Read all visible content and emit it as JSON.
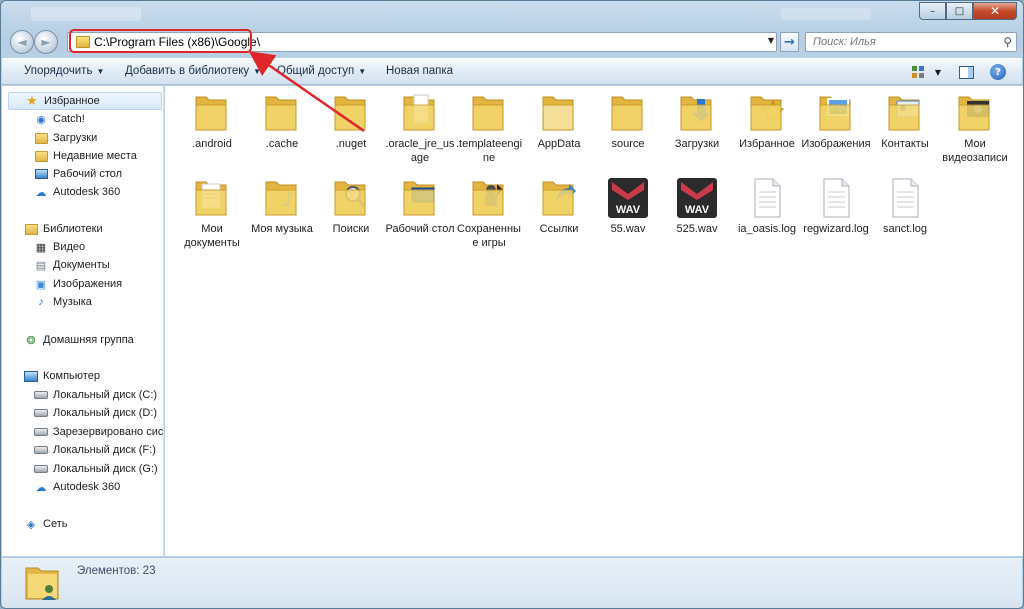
{
  "window": {
    "controls": {
      "minimize": "–",
      "maximize": "□",
      "close": "✕"
    }
  },
  "nav": {
    "back_icon": "◄",
    "forward_icon": "►",
    "address": "C:\\Program Files (x86)\\Google\\",
    "go_icon": "→",
    "search_placeholder": "Поиск: Илья"
  },
  "toolbar": {
    "organize": "Упорядочить",
    "add_to_library": "Добавить в библиотеку",
    "share": "Общий доступ",
    "new_folder": "Новая папка"
  },
  "sidebar": {
    "favorites": "Избранное",
    "favorites_items": [
      "Catch!",
      "Загрузки",
      "Недавние места",
      "Рабочий стол",
      "Autodesk 360"
    ],
    "libraries": "Библиотеки",
    "libraries_items": [
      "Видео",
      "Документы",
      "Изображения",
      "Музыка"
    ],
    "homegroup": "Домашняя группа",
    "computer": "Компьютер",
    "computer_items": [
      "Локальный диск (C:)",
      "Локальный диск (D:)",
      "Зарезервировано системой",
      "Локальный диск (F:)",
      "Локальный диск (G:)",
      "Autodesk 360"
    ],
    "network": "Сеть"
  },
  "files": [
    {
      "name": ".android",
      "type": "folder"
    },
    {
      "name": ".cache",
      "type": "folder"
    },
    {
      "name": ".nuget",
      "type": "folder"
    },
    {
      "name": ".oracle_jre_usage",
      "type": "folder-paper"
    },
    {
      "name": ".templateengine",
      "type": "folder"
    },
    {
      "name": "AppData",
      "type": "folder-light"
    },
    {
      "name": "source",
      "type": "folder"
    },
    {
      "name": "Загрузки",
      "type": "folder-download"
    },
    {
      "name": "Избранное",
      "type": "folder-star"
    },
    {
      "name": "Изображения",
      "type": "folder-picture"
    },
    {
      "name": "Контакты",
      "type": "folder-contacts"
    },
    {
      "name": "Мои видеозаписи",
      "type": "folder-video"
    },
    {
      "name": "Мои документы",
      "type": "folder-docs"
    },
    {
      "name": "Моя музыка",
      "type": "folder-music"
    },
    {
      "name": "Поиски",
      "type": "folder-search"
    },
    {
      "name": "Рабочий стол",
      "type": "folder-desktop"
    },
    {
      "name": "Сохраненные игры",
      "type": "folder-games"
    },
    {
      "name": "Ссылки",
      "type": "folder-links"
    },
    {
      "name": "55.wav",
      "type": "wav",
      "badge": "WAV"
    },
    {
      "name": "525.wav",
      "type": "wav",
      "badge": "WAV"
    },
    {
      "name": "ia_oasis.log",
      "type": "log"
    },
    {
      "name": "regwizard.log",
      "type": "log"
    },
    {
      "name": "sanct.log",
      "type": "log"
    }
  ],
  "status": {
    "items_count": "Элементов: 23"
  },
  "colors": {
    "highlight": "#e0252b",
    "folder": "#f1cf62"
  }
}
